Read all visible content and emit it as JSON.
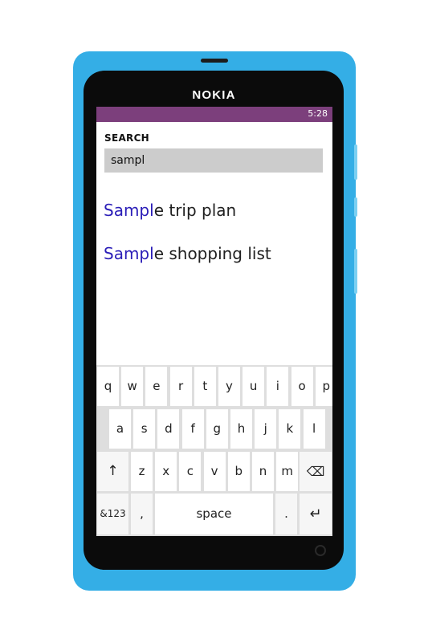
{
  "device": {
    "brand": "NOKIA"
  },
  "status_bar": {
    "time": "5:28",
    "color": "#7c3f7c"
  },
  "search": {
    "label": "SEARCH",
    "value": "sampl"
  },
  "results": [
    {
      "highlight": "Sampl",
      "rest": "e trip plan"
    },
    {
      "highlight": "Sampl",
      "rest": "e shopping list"
    }
  ],
  "keyboard": {
    "row1": [
      "q",
      "w",
      "e",
      "r",
      "t",
      "y",
      "u",
      "i",
      "o",
      "p"
    ],
    "row2": [
      "a",
      "s",
      "d",
      "f",
      "g",
      "h",
      "j",
      "k",
      "l"
    ],
    "row3": [
      "z",
      "x",
      "c",
      "v",
      "b",
      "n",
      "m"
    ],
    "shift": "↑",
    "backspace": "⌫",
    "symbols": "&123",
    "comma": ",",
    "space": "space",
    "period": ".",
    "enter": "↵"
  },
  "colors": {
    "phone_body": "#34aee6",
    "highlight_text": "#2b1eb8",
    "search_box": "#cccccc"
  }
}
